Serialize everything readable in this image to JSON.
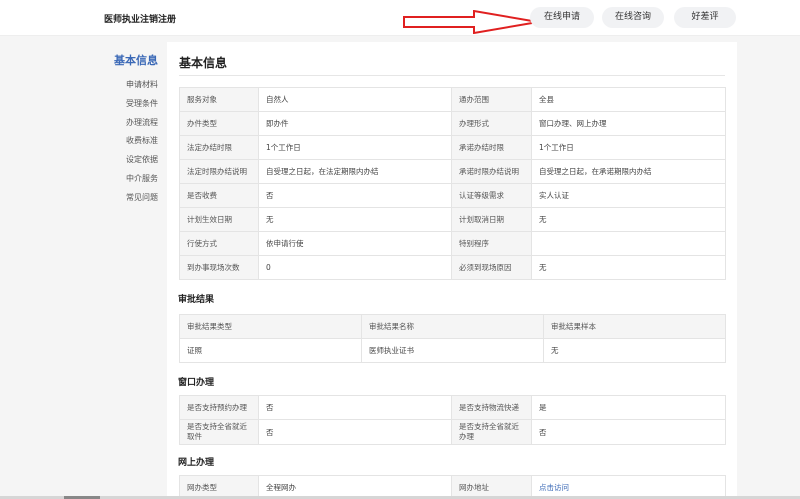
{
  "header": {
    "title": "医师执业注销注册",
    "buttons": [
      "在线申请",
      "在线咨询",
      "好差评"
    ]
  },
  "sidebar": {
    "active": "基本信息",
    "items": [
      "申请材料",
      "受理条件",
      "办理流程",
      "收费标准",
      "设定依据",
      "中介服务",
      "常见问题"
    ]
  },
  "basic": {
    "title": "基本信息",
    "rows": [
      [
        "服务对象",
        "自然人",
        "通办范围",
        "全县"
      ],
      [
        "办件类型",
        "即办件",
        "办理形式",
        "窗口办理、网上办理"
      ],
      [
        "法定办结时限",
        "1个工作日",
        "承诺办结时限",
        "1个工作日"
      ],
      [
        "法定时限办结说明",
        "自受理之日起，在法定期限内办结",
        "承诺时限办结说明",
        "自受理之日起，在承诺期限内办结"
      ],
      [
        "是否收费",
        "否",
        "认证等级需求",
        "实人认证"
      ],
      [
        "计划生效日期",
        "无",
        "计划取消日期",
        "无"
      ],
      [
        "行使方式",
        "依申请行使",
        "特别程序",
        ""
      ],
      [
        "到办事现场次数",
        "0",
        "必须到现场原因",
        "无"
      ]
    ]
  },
  "result": {
    "title": "审批结果",
    "headers": [
      "审批结果类型",
      "审批结果名称",
      "审批结果样本"
    ],
    "row": [
      "证照",
      "医师执业证书",
      "无"
    ]
  },
  "window": {
    "title": "窗口办理",
    "rows": [
      [
        "是否支持预约办理",
        "否",
        "是否支持物流快递",
        "是"
      ],
      [
        "是否支持全省就近取件",
        "否",
        "是否支持全省就近办理",
        "否"
      ]
    ]
  },
  "online": {
    "title": "网上办理",
    "row": [
      "网办类型",
      "全程网办",
      "网办地址",
      "点击访问"
    ]
  },
  "colors": {
    "accent": "#3a68b6",
    "arrow": "#e02020"
  },
  "icons": {
    "annotation": "red-arrow-icon"
  }
}
